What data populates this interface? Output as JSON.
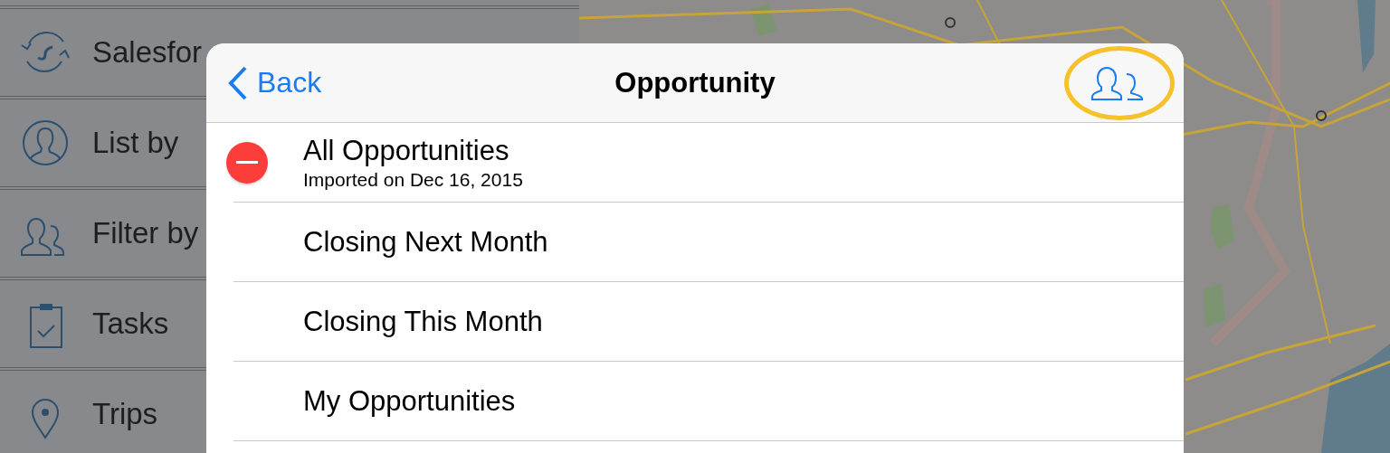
{
  "sidebar": {
    "items": [
      {
        "label": "Salesfor"
      },
      {
        "label": "List by"
      },
      {
        "label": "Filter by"
      },
      {
        "label": "Tasks"
      },
      {
        "label": "Trips"
      }
    ]
  },
  "sheet": {
    "back": "Back",
    "title": "Opportunity",
    "highlighted_action": true,
    "rows": [
      {
        "title": "All Opportunities",
        "subtitle": "Imported on Dec 16, 2015",
        "deletable": true
      },
      {
        "title": "Closing Next Month",
        "deletable": false
      },
      {
        "title": "Closing This Month",
        "deletable": false
      },
      {
        "title": "My Opportunities",
        "deletable": false
      }
    ]
  }
}
